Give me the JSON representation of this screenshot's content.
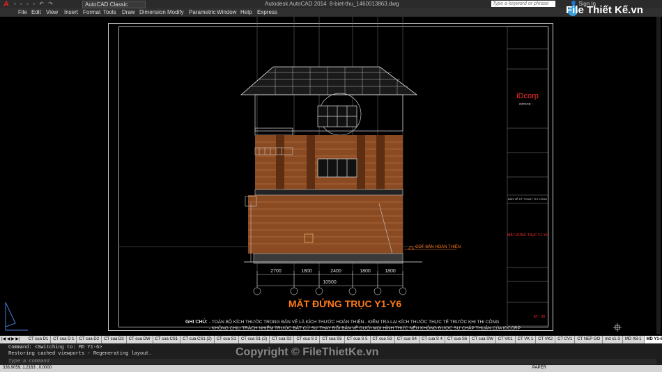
{
  "titlebar": {
    "app_title": "Autodesk AutoCAD 2014",
    "file_name": "8-biet-thu_1460013863.dwg",
    "workspace": "AutoCAD Classic",
    "search_placeholder": "Type a keyword or phrase",
    "signin": "Sign In"
  },
  "menu": [
    "File",
    "Edit",
    "View",
    "Insert",
    "Format",
    "Tools",
    "Draw",
    "Dimension",
    "Modify",
    "Parametric",
    "Window",
    "Help",
    "Express"
  ],
  "logo": "File Thiết Kế.vn",
  "drawing": {
    "title": "MẶT ĐỨNG TRỤC Y1-Y6",
    "level_label": "COT SÀN HOÀN THIỆN",
    "dimensions": [
      "2700",
      "1800",
      "2400",
      "1800",
      "1800"
    ],
    "total_dimension": "10500",
    "note_label": "GHI CHÚ:",
    "note_line1": "- TOÀN BỘ KÍCH THƯỚC TRONG BẢN VẼ LÀ KÍCH THƯỚC HOÀN THIỆN - KIỂM TRA LẠI KÍCH THƯỚC THỰC TẾ TRƯỚC KHI THI CÔNG",
    "note_line2": "- KHÔNG CHỊU TRÁCH NHIỆM TRƯỚC BẤT CỨ SỰ THAY ĐỔI BẢN VẼ DƯỚI MỌI HÌNH THỨC NẾU KHÔNG ĐƯỢC SỰ CHẤP THUẬN CỦA IDCORP"
  },
  "title_block": {
    "company": "iDcorp",
    "office": "OFFICE :",
    "drawing_name": "MẶT ĐỨNG TRỤC Y1-Y6",
    "drawing_no": "KT - 30",
    "stage": "BẢN VẼ KỸ THUẬT THI CÔNG"
  },
  "tabs": [
    "CT cua D1",
    "CT cua D 1",
    "CT cua D2",
    "CT cua D3",
    "CT cua DW",
    "CT cua CS1",
    "CT cua CS1 (2)",
    "CT cua S1",
    "CT cua S1 (2)",
    "CT cua S2",
    "CT cua S 2",
    "CT cua S5",
    "CT cua S 5",
    "CT cua S3",
    "CT cua S4",
    "CT cua S 4",
    "CT cua S6",
    "CT cua SW",
    "CT VK1",
    "CT VK 1",
    "CT VK2",
    "CT CV1",
    "CT NEP GO",
    "md x1-3",
    "MD X8-1",
    "MD Y1-6"
  ],
  "command": {
    "line1": "Command:   <Switching to: MD Y1-6>",
    "line2": "Restoring cached viewports - Regenerating layout.",
    "prompt": "Type a command"
  },
  "status": {
    "coords": "336.9059, 1.2163 , 0.0000",
    "mode": "PAPER"
  },
  "watermark": "Copyright © FileThietKe.vn",
  "colors": {
    "brick": "#8a4a22",
    "title_orange": "#ff7a1a",
    "accent_red": "#ff3030"
  }
}
